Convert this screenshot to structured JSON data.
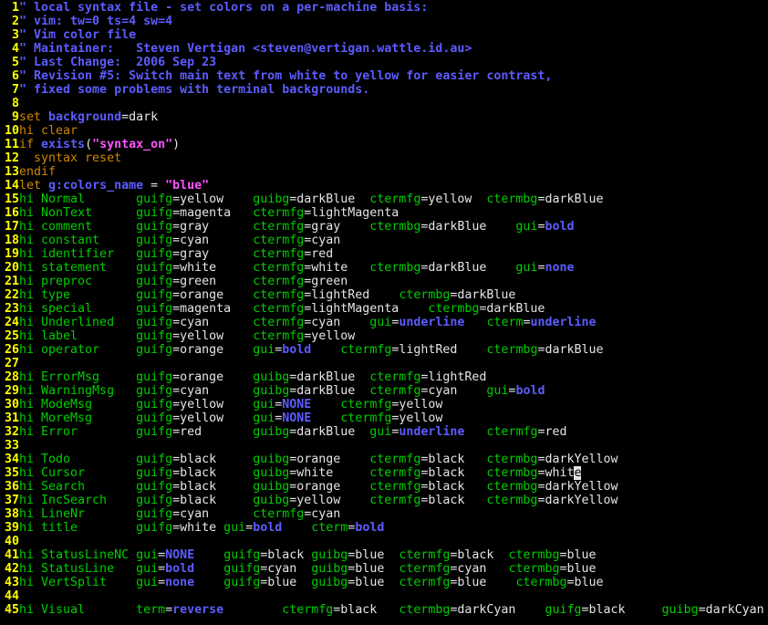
{
  "lines": [
    {
      "n": "1",
      "segs": [
        [
          "comment",
          "\" local syntax file - set colors on a per-machine basis:"
        ]
      ]
    },
    {
      "n": "2",
      "segs": [
        [
          "comment",
          "\" vim: tw=0 ts=4 sw=4"
        ]
      ]
    },
    {
      "n": "3",
      "segs": [
        [
          "comment",
          "\" Vim color file"
        ]
      ]
    },
    {
      "n": "4",
      "segs": [
        [
          "comment",
          "\" Maintainer:   Steven Vertigan <steven@vertigan.wattle.id.au>"
        ]
      ]
    },
    {
      "n": "5",
      "segs": [
        [
          "comment",
          "\" Last Change:  2006 Sep 23"
        ]
      ]
    },
    {
      "n": "6",
      "segs": [
        [
          "comment",
          "\" Revision #5: Switch main text from white to yellow for easier contrast,"
        ]
      ]
    },
    {
      "n": "7",
      "segs": [
        [
          "comment",
          "\" fixed some problems with terminal backgrounds."
        ]
      ]
    },
    {
      "n": "8",
      "segs": []
    },
    {
      "n": "9",
      "segs": [
        [
          "stmt",
          "set "
        ],
        [
          "ident",
          "background"
        ],
        [
          "plain",
          "=dark"
        ]
      ]
    },
    {
      "n": "10",
      "segs": [
        [
          "stmt",
          "hi clear"
        ]
      ]
    },
    {
      "n": "11",
      "segs": [
        [
          "stmt",
          "if "
        ],
        [
          "ident",
          "exists"
        ],
        [
          "plain",
          "("
        ],
        [
          "str",
          "\"syntax_on\""
        ],
        [
          "plain",
          ")"
        ]
      ]
    },
    {
      "n": "12",
      "segs": [
        [
          "stmt",
          "  syntax reset"
        ]
      ]
    },
    {
      "n": "13",
      "segs": [
        [
          "stmt",
          "endif"
        ]
      ]
    },
    {
      "n": "14",
      "segs": [
        [
          "stmt",
          "let "
        ],
        [
          "ident",
          "g:colors_name"
        ],
        [
          "plain",
          " = "
        ],
        [
          "str",
          "\"blue\""
        ]
      ]
    },
    {
      "n": "15",
      "segs": [
        [
          "green",
          "hi Normal       guifg"
        ],
        [
          "plain",
          "=yellow    "
        ],
        [
          "green",
          "guibg"
        ],
        [
          "plain",
          "=darkBlue  "
        ],
        [
          "green",
          "ctermfg"
        ],
        [
          "plain",
          "=yellow  "
        ],
        [
          "green",
          "ctermbg"
        ],
        [
          "plain",
          "=darkBlue"
        ]
      ]
    },
    {
      "n": "16",
      "segs": [
        [
          "green",
          "hi NonText      guifg"
        ],
        [
          "plain",
          "=magenta   "
        ],
        [
          "green",
          "ctermfg"
        ],
        [
          "plain",
          "=lightMagenta"
        ]
      ]
    },
    {
      "n": "17",
      "segs": [
        [
          "green",
          "hi comment      guifg"
        ],
        [
          "plain",
          "=gray      "
        ],
        [
          "green",
          "ctermfg"
        ],
        [
          "plain",
          "=gray    "
        ],
        [
          "green",
          "ctermbg"
        ],
        [
          "plain",
          "=darkBlue    "
        ],
        [
          "green",
          "gui"
        ],
        [
          "plain",
          "="
        ],
        [
          "bold",
          "bold"
        ]
      ]
    },
    {
      "n": "18",
      "segs": [
        [
          "green",
          "hi constant     guifg"
        ],
        [
          "plain",
          "=cyan      "
        ],
        [
          "green",
          "ctermfg"
        ],
        [
          "plain",
          "=cyan"
        ]
      ]
    },
    {
      "n": "19",
      "segs": [
        [
          "green",
          "hi identifier   guifg"
        ],
        [
          "plain",
          "=gray      "
        ],
        [
          "green",
          "ctermfg"
        ],
        [
          "plain",
          "=red"
        ]
      ]
    },
    {
      "n": "20",
      "segs": [
        [
          "green",
          "hi statement    guifg"
        ],
        [
          "plain",
          "=white     "
        ],
        [
          "green",
          "ctermfg"
        ],
        [
          "plain",
          "=white   "
        ],
        [
          "green",
          "ctermbg"
        ],
        [
          "plain",
          "=darkBlue    "
        ],
        [
          "green",
          "gui"
        ],
        [
          "plain",
          "="
        ],
        [
          "bold",
          "none"
        ]
      ]
    },
    {
      "n": "21",
      "segs": [
        [
          "green",
          "hi preproc      guifg"
        ],
        [
          "plain",
          "=green     "
        ],
        [
          "green",
          "ctermfg"
        ],
        [
          "plain",
          "=green"
        ]
      ]
    },
    {
      "n": "22",
      "segs": [
        [
          "green",
          "hi type         guifg"
        ],
        [
          "plain",
          "=orange    "
        ],
        [
          "green",
          "ctermfg"
        ],
        [
          "plain",
          "=lightRed    "
        ],
        [
          "green",
          "ctermbg"
        ],
        [
          "plain",
          "=darkBlue"
        ]
      ]
    },
    {
      "n": "23",
      "segs": [
        [
          "green",
          "hi special      guifg"
        ],
        [
          "plain",
          "=magenta   "
        ],
        [
          "green",
          "ctermfg"
        ],
        [
          "plain",
          "=lightMagenta    "
        ],
        [
          "green",
          "ctermbg"
        ],
        [
          "plain",
          "=darkBlue"
        ]
      ]
    },
    {
      "n": "24",
      "segs": [
        [
          "green",
          "hi Underlined   guifg"
        ],
        [
          "plain",
          "=cyan      "
        ],
        [
          "green",
          "ctermfg"
        ],
        [
          "plain",
          "=cyan    "
        ],
        [
          "green",
          "gui"
        ],
        [
          "plain",
          "="
        ],
        [
          "bold",
          "underline"
        ],
        [
          "plain",
          "   "
        ],
        [
          "green",
          "cterm"
        ],
        [
          "plain",
          "="
        ],
        [
          "bold",
          "underline"
        ]
      ]
    },
    {
      "n": "25",
      "segs": [
        [
          "green",
          "hi label        guifg"
        ],
        [
          "plain",
          "=yellow    "
        ],
        [
          "green",
          "ctermfg"
        ],
        [
          "plain",
          "=yellow"
        ]
      ]
    },
    {
      "n": "26",
      "segs": [
        [
          "green",
          "hi operator     guifg"
        ],
        [
          "plain",
          "=orange    "
        ],
        [
          "green",
          "gui"
        ],
        [
          "plain",
          "="
        ],
        [
          "bold",
          "bold"
        ],
        [
          "plain",
          "    "
        ],
        [
          "green",
          "ctermfg"
        ],
        [
          "plain",
          "=lightRed    "
        ],
        [
          "green",
          "ctermbg"
        ],
        [
          "plain",
          "=darkBlue"
        ]
      ]
    },
    {
      "n": "27",
      "segs": []
    },
    {
      "n": "28",
      "segs": [
        [
          "green",
          "hi ErrorMsg     guifg"
        ],
        [
          "plain",
          "=orange    "
        ],
        [
          "green",
          "guibg"
        ],
        [
          "plain",
          "=darkBlue  "
        ],
        [
          "green",
          "ctermfg"
        ],
        [
          "plain",
          "=lightRed"
        ]
      ]
    },
    {
      "n": "29",
      "segs": [
        [
          "green",
          "hi WarningMsg   guifg"
        ],
        [
          "plain",
          "=cyan      "
        ],
        [
          "green",
          "guibg"
        ],
        [
          "plain",
          "=darkBlue  "
        ],
        [
          "green",
          "ctermfg"
        ],
        [
          "plain",
          "=cyan    "
        ],
        [
          "green",
          "gui"
        ],
        [
          "plain",
          "="
        ],
        [
          "bold",
          "bold"
        ]
      ]
    },
    {
      "n": "30",
      "segs": [
        [
          "green",
          "hi ModeMsg      guifg"
        ],
        [
          "plain",
          "=yellow    "
        ],
        [
          "green",
          "gui"
        ],
        [
          "plain",
          "="
        ],
        [
          "bold",
          "NONE"
        ],
        [
          "plain",
          "    "
        ],
        [
          "green",
          "ctermfg"
        ],
        [
          "plain",
          "=yellow"
        ]
      ]
    },
    {
      "n": "31",
      "segs": [
        [
          "green",
          "hi MoreMsg      guifg"
        ],
        [
          "plain",
          "=yellow    "
        ],
        [
          "green",
          "gui"
        ],
        [
          "plain",
          "="
        ],
        [
          "bold",
          "NONE"
        ],
        [
          "plain",
          "    "
        ],
        [
          "green",
          "ctermfg"
        ],
        [
          "plain",
          "=yellow"
        ]
      ]
    },
    {
      "n": "32",
      "segs": [
        [
          "green",
          "hi Error        guifg"
        ],
        [
          "plain",
          "=red       "
        ],
        [
          "green",
          "guibg"
        ],
        [
          "plain",
          "=darkBlue  "
        ],
        [
          "green",
          "gui"
        ],
        [
          "plain",
          "="
        ],
        [
          "bold",
          "underline"
        ],
        [
          "plain",
          "   "
        ],
        [
          "green",
          "ctermfg"
        ],
        [
          "plain",
          "=red"
        ]
      ]
    },
    {
      "n": "33",
      "segs": []
    },
    {
      "n": "34",
      "segs": [
        [
          "green",
          "hi Todo         guifg"
        ],
        [
          "plain",
          "=black     "
        ],
        [
          "green",
          "guibg"
        ],
        [
          "plain",
          "=orange    "
        ],
        [
          "green",
          "ctermfg"
        ],
        [
          "plain",
          "=black   "
        ],
        [
          "green",
          "ctermbg"
        ],
        [
          "plain",
          "=darkYellow"
        ]
      ]
    },
    {
      "n": "35",
      "segs": [
        [
          "green",
          "hi Cursor       guifg"
        ],
        [
          "plain",
          "=black     "
        ],
        [
          "green",
          "guibg"
        ],
        [
          "plain",
          "=white     "
        ],
        [
          "green",
          "ctermfg"
        ],
        [
          "plain",
          "=black   "
        ],
        [
          "green",
          "ctermbg"
        ],
        [
          "plain",
          "=whit"
        ],
        [
          "cursor",
          "e"
        ]
      ]
    },
    {
      "n": "36",
      "segs": [
        [
          "green",
          "hi Search       guifg"
        ],
        [
          "plain",
          "=black     "
        ],
        [
          "green",
          "guibg"
        ],
        [
          "plain",
          "=orange    "
        ],
        [
          "green",
          "ctermfg"
        ],
        [
          "plain",
          "=black   "
        ],
        [
          "green",
          "ctermbg"
        ],
        [
          "plain",
          "=darkYellow"
        ]
      ]
    },
    {
      "n": "37",
      "segs": [
        [
          "green",
          "hi IncSearch    guifg"
        ],
        [
          "plain",
          "=black     "
        ],
        [
          "green",
          "guibg"
        ],
        [
          "plain",
          "=yellow    "
        ],
        [
          "green",
          "ctermfg"
        ],
        [
          "plain",
          "=black   "
        ],
        [
          "green",
          "ctermbg"
        ],
        [
          "plain",
          "=darkYellow"
        ]
      ]
    },
    {
      "n": "38",
      "segs": [
        [
          "green",
          "hi LineNr       guifg"
        ],
        [
          "plain",
          "=cyan      "
        ],
        [
          "green",
          "ctermfg"
        ],
        [
          "plain",
          "=cyan"
        ]
      ]
    },
    {
      "n": "39",
      "segs": [
        [
          "green",
          "hi title        guifg"
        ],
        [
          "plain",
          "=white "
        ],
        [
          "green",
          "gui"
        ],
        [
          "plain",
          "="
        ],
        [
          "bold",
          "bold"
        ],
        [
          "plain",
          "    "
        ],
        [
          "green",
          "cterm"
        ],
        [
          "plain",
          "="
        ],
        [
          "bold",
          "bold"
        ]
      ]
    },
    {
      "n": "40",
      "segs": []
    },
    {
      "n": "41",
      "segs": [
        [
          "green",
          "hi StatusLineNC gui"
        ],
        [
          "plain",
          "="
        ],
        [
          "bold",
          "NONE"
        ],
        [
          "plain",
          "    "
        ],
        [
          "green",
          "guifg"
        ],
        [
          "plain",
          "=black "
        ],
        [
          "green",
          "guibg"
        ],
        [
          "plain",
          "=blue  "
        ],
        [
          "green",
          "ctermfg"
        ],
        [
          "plain",
          "=black  "
        ],
        [
          "green",
          "ctermbg"
        ],
        [
          "plain",
          "=blue"
        ]
      ]
    },
    {
      "n": "42",
      "segs": [
        [
          "green",
          "hi StatusLine   gui"
        ],
        [
          "plain",
          "="
        ],
        [
          "bold",
          "bold"
        ],
        [
          "plain",
          "    "
        ],
        [
          "green",
          "guifg"
        ],
        [
          "plain",
          "=cyan  "
        ],
        [
          "green",
          "guibg"
        ],
        [
          "plain",
          "=blue  "
        ],
        [
          "green",
          "ctermfg"
        ],
        [
          "plain",
          "=cyan   "
        ],
        [
          "green",
          "ctermbg"
        ],
        [
          "plain",
          "=blue"
        ]
      ]
    },
    {
      "n": "43",
      "segs": [
        [
          "green",
          "hi VertSplit    gui"
        ],
        [
          "plain",
          "="
        ],
        [
          "bold",
          "none"
        ],
        [
          "plain",
          "    "
        ],
        [
          "green",
          "guifg"
        ],
        [
          "plain",
          "=blue  "
        ],
        [
          "green",
          "guibg"
        ],
        [
          "plain",
          "=blue  "
        ],
        [
          "green",
          "ctermfg"
        ],
        [
          "plain",
          "=blue    "
        ],
        [
          "green",
          "ctermbg"
        ],
        [
          "plain",
          "=blue"
        ]
      ]
    },
    {
      "n": "44",
      "segs": []
    },
    {
      "n": "45",
      "segs": [
        [
          "green",
          "hi Visual       term"
        ],
        [
          "plain",
          "="
        ],
        [
          "bold",
          "reverse"
        ],
        [
          "plain",
          "        "
        ],
        [
          "green",
          "ctermfg"
        ],
        [
          "plain",
          "=black   "
        ],
        [
          "green",
          "ctermbg"
        ],
        [
          "plain",
          "=darkCyan    "
        ],
        [
          "green",
          "guifg"
        ],
        [
          "plain",
          "=black     "
        ],
        [
          "green",
          "guibg"
        ],
        [
          "plain",
          "=darkCyan"
        ]
      ]
    }
  ]
}
